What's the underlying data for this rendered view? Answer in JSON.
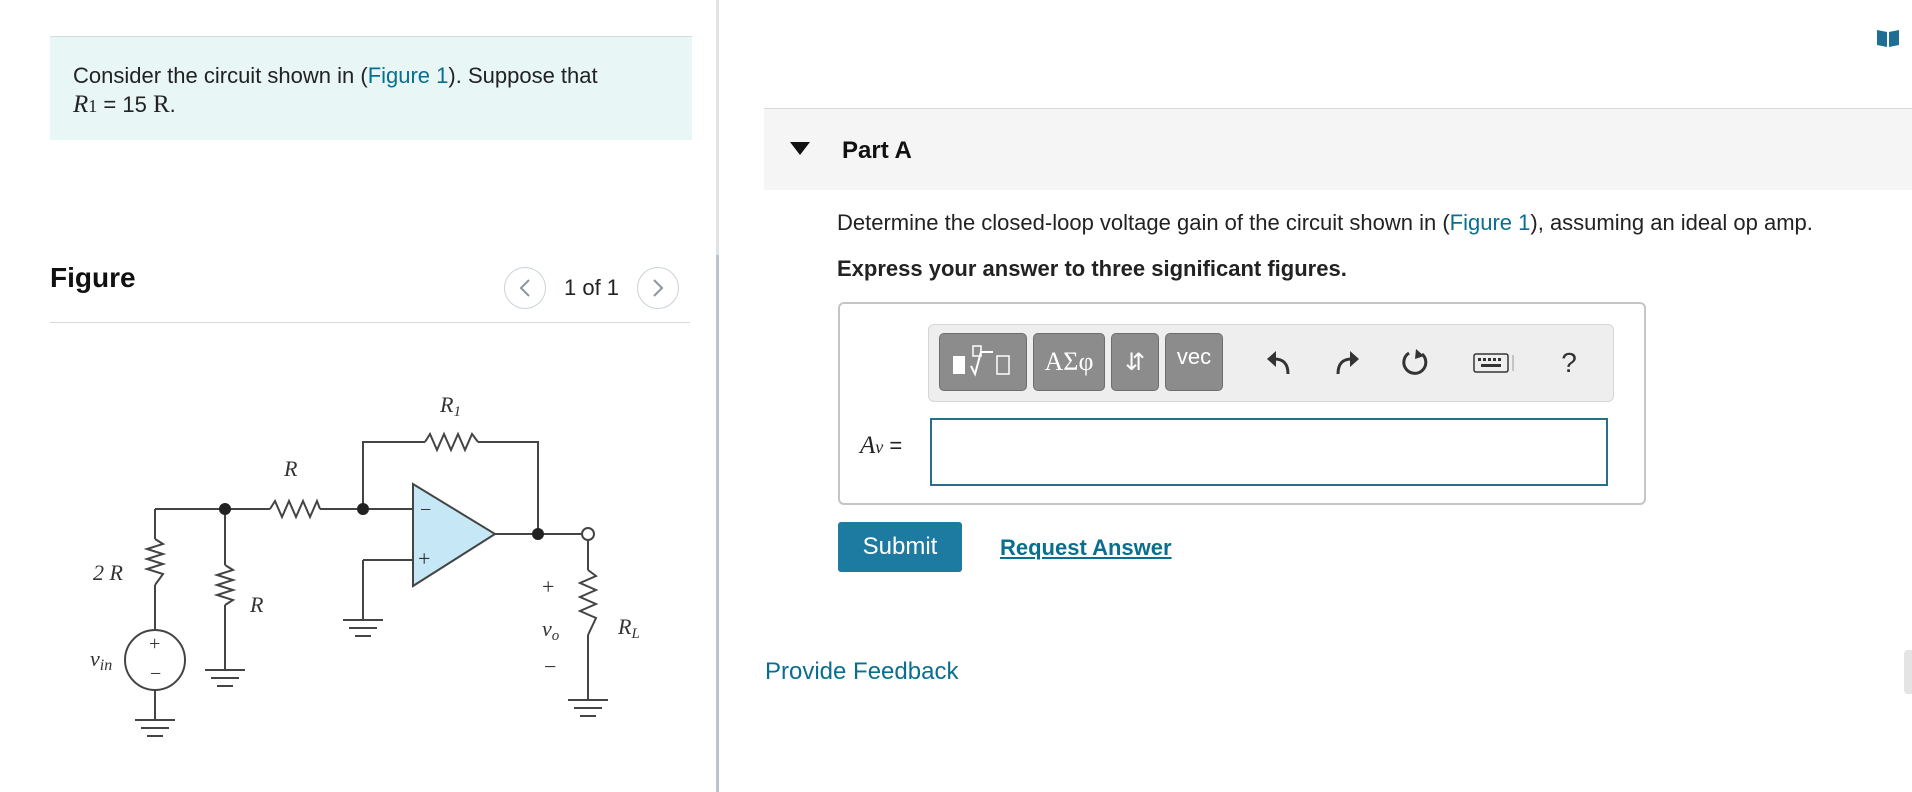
{
  "problem": {
    "intro_before": "Consider the circuit shown in (",
    "figure_link": "Figure 1",
    "intro_after": "). Suppose that",
    "condition_var": "R",
    "condition_sub": "1",
    "condition_rest": " = 15 ",
    "condition_unit": "R",
    "condition_end": "."
  },
  "figure": {
    "title": "Figure",
    "pager_text": "1 of 1",
    "prev_icon": "chevron-left-icon",
    "next_icon": "chevron-right-icon",
    "labels": {
      "r_top": "R",
      "r_top_sub": "1",
      "r_series": "R",
      "r_shunt": "R",
      "r_input": "2 R",
      "source": "v",
      "source_sub": "in",
      "output": "v",
      "output_sub": "o",
      "load": "R",
      "load_sub": "L",
      "plus": "+",
      "minus": "−",
      "opamp_minus": "−",
      "opamp_plus": "+"
    }
  },
  "partA": {
    "title": "Part A",
    "question_before": "Determine the closed-loop voltage gain of the circuit shown in (",
    "question_link": "Figure 1",
    "question_after": "), assuming an ideal op amp.",
    "instruction": "Express your answer to three significant figures.",
    "variable": "A",
    "variable_sub": "v",
    "equals": " =",
    "answer_value": "",
    "toolbar": {
      "greek": "ΑΣφ",
      "arrows": "⇵",
      "vec": "vec",
      "help": "?"
    },
    "submit_label": "Submit",
    "request_label": "Request Answer"
  },
  "feedback_label": "Provide Feedback",
  "colors": {
    "link": "#0a6f8f",
    "submit": "#1d7aa0",
    "prompt_bg": "#e8f6f6",
    "opamp_fill": "#c6e8f6"
  }
}
